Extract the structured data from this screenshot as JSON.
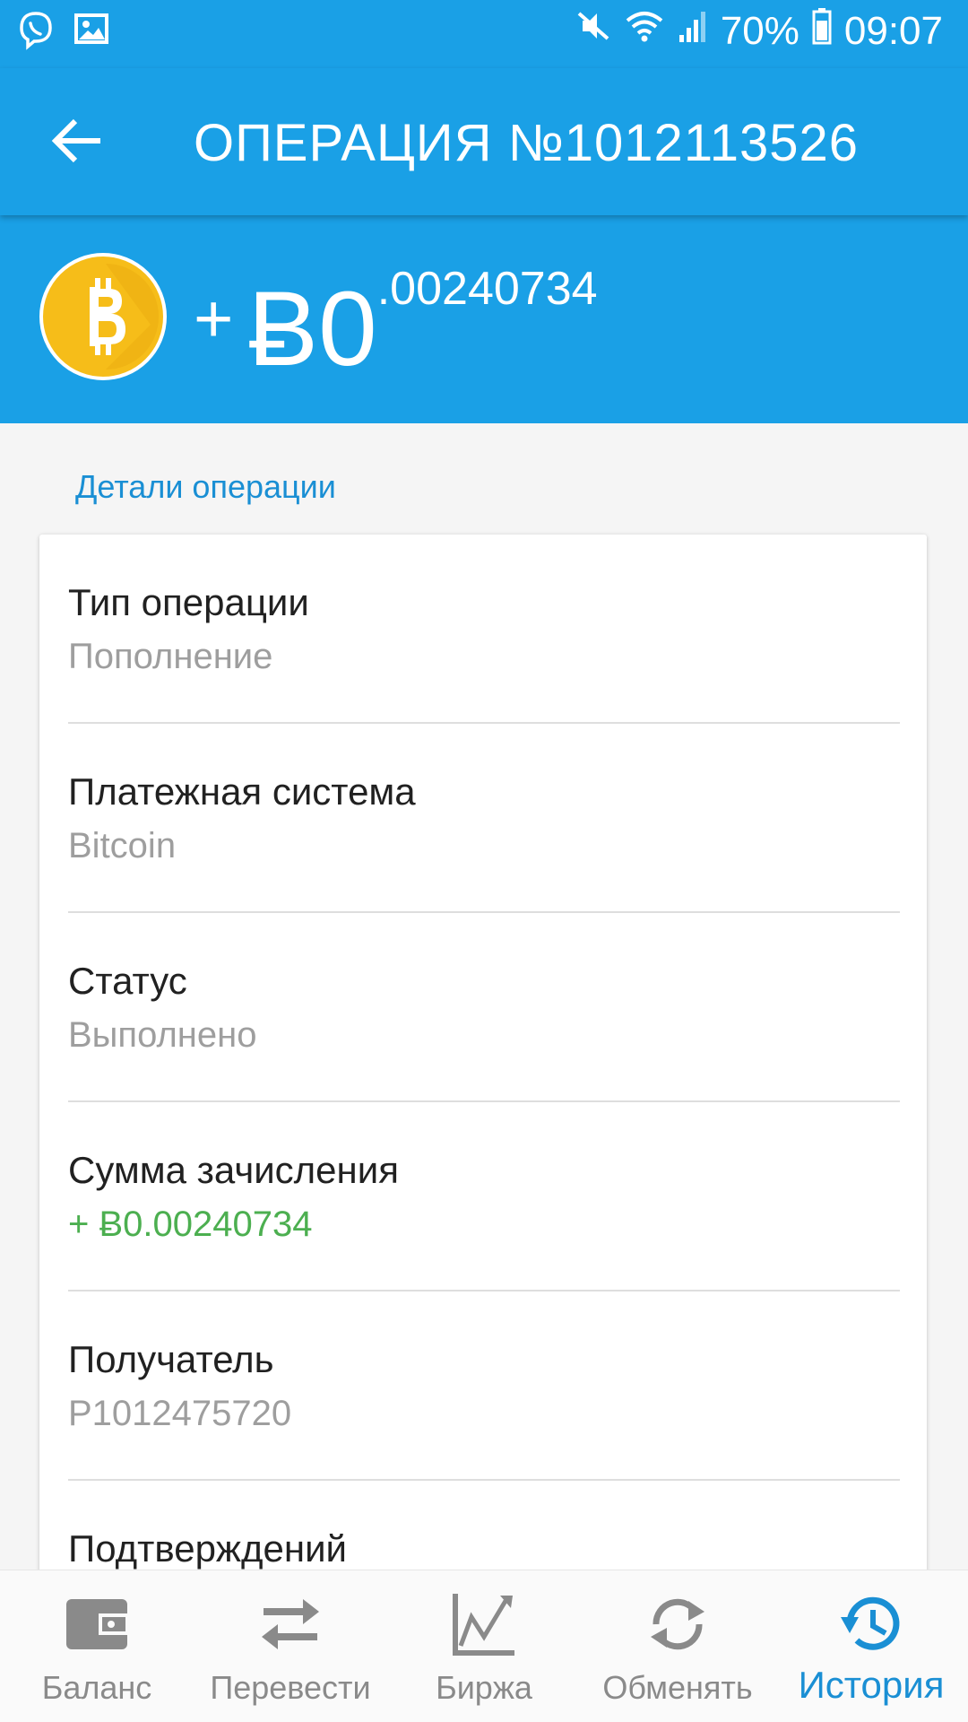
{
  "status_bar": {
    "battery_text": "70%",
    "time": "09:07",
    "icons_left": [
      "viber-icon",
      "gallery-icon"
    ],
    "icons_right": [
      "mute-icon",
      "wifi-icon",
      "signal-icon",
      "battery-icon"
    ]
  },
  "app_bar": {
    "title": "ОПЕРАЦИЯ №1012113526"
  },
  "amount": {
    "sign": "+",
    "integer": "Ƀ0",
    "fraction": ".00240734"
  },
  "details": {
    "section_title": "Детали операции",
    "rows": [
      {
        "label": "Тип операции",
        "value": "Пополнение"
      },
      {
        "label": "Платежная система",
        "value": "Bitcoin"
      },
      {
        "label": "Статус",
        "value": "Выполнено"
      },
      {
        "label": "Сумма зачисления",
        "value": "+ Ƀ0.00240734"
      },
      {
        "label": "Получатель",
        "value": "P1012475720"
      },
      {
        "label": "Подтверждений",
        "value": ""
      }
    ]
  },
  "bottom_nav": [
    {
      "label": "Баланс",
      "icon": "wallet-icon",
      "active": false
    },
    {
      "label": "Перевести",
      "icon": "transfer-icon",
      "active": false
    },
    {
      "label": "Биржа",
      "icon": "chart-icon",
      "active": false
    },
    {
      "label": "Обменять",
      "icon": "exchange-icon",
      "active": false
    },
    {
      "label": "История",
      "icon": "history-icon",
      "active": true
    }
  ],
  "colors": {
    "primary": "#1aa0e6",
    "accent": "#1a8fd4",
    "coin": "#f6bd19",
    "positive": "#4caf50"
  }
}
